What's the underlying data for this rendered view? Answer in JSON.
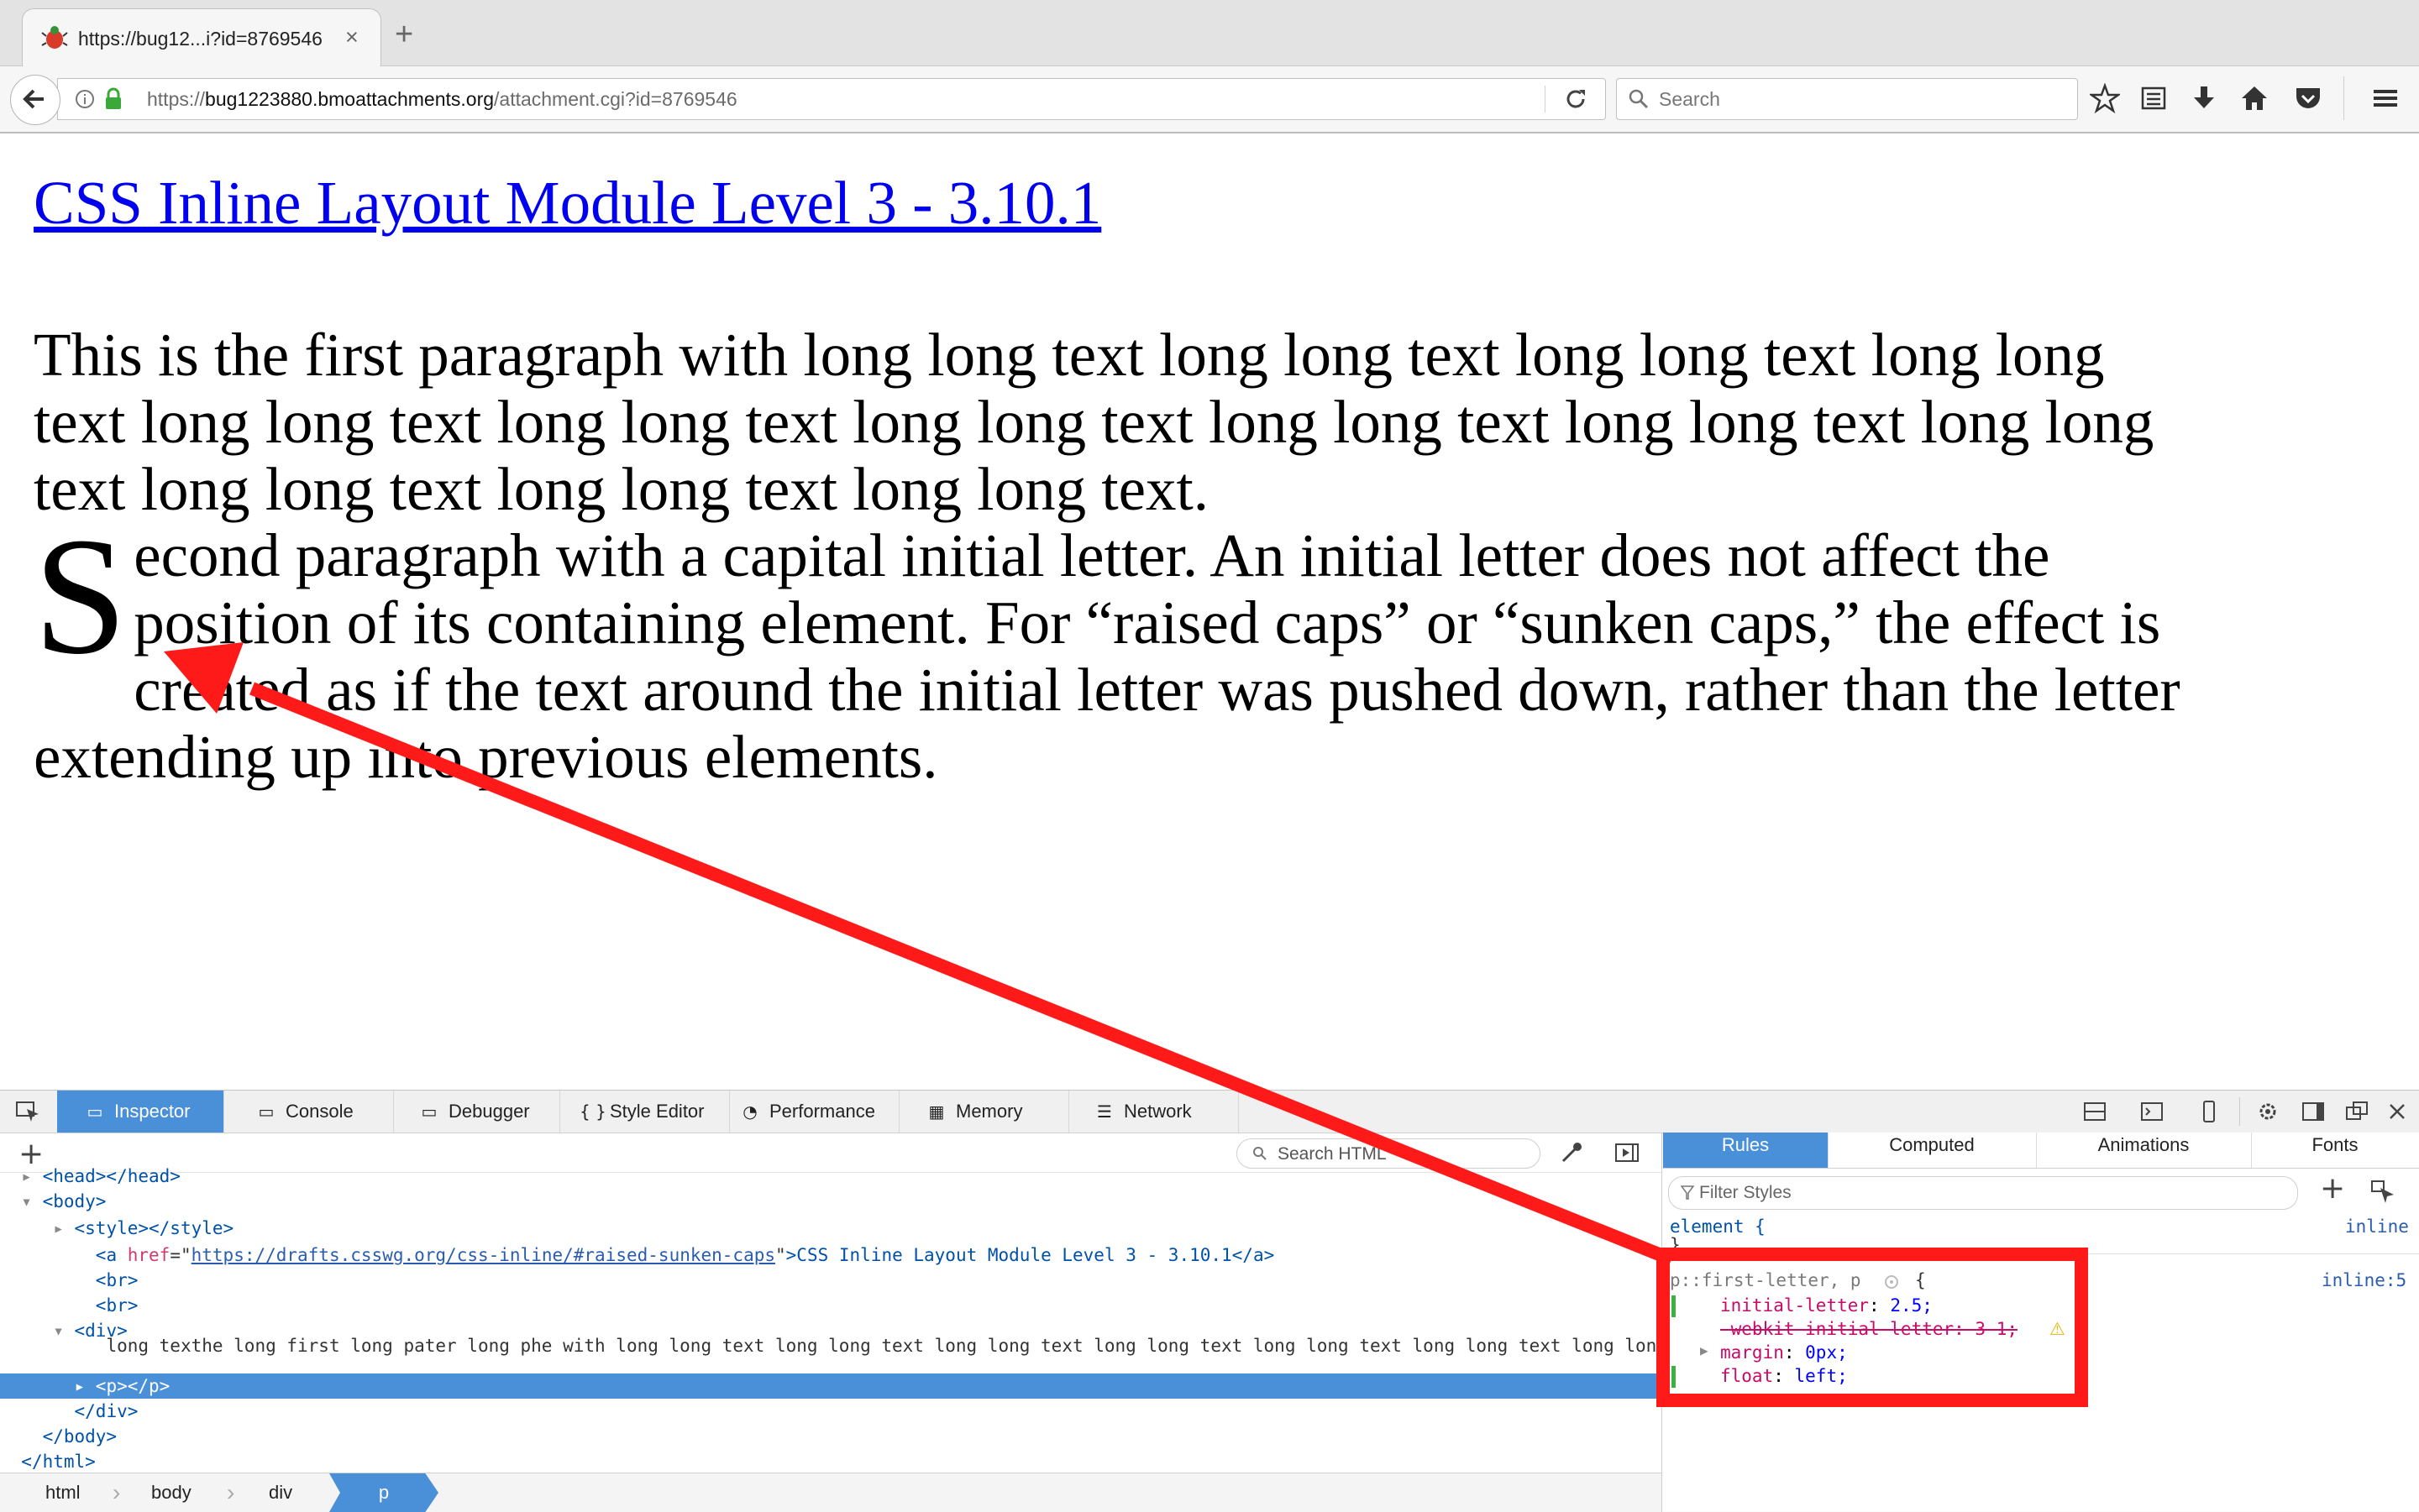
{
  "browser": {
    "tab_title": "https://bug12...i?id=8769546",
    "close_symbol": "×",
    "new_tab_symbol": "+",
    "url_prefix": "https://",
    "url_host": "bug1223880.bmoattachments.org",
    "url_path": "/attachment.cgi?id=8769546",
    "search_placeholder": "Search",
    "icons": [
      "back-icon",
      "info-icon",
      "lock-icon",
      "reload-icon",
      "search-icon",
      "star-icon",
      "reading-list-icon",
      "download-icon",
      "home-icon",
      "pocket-icon",
      "menu-icon"
    ]
  },
  "page": {
    "link_text": "CSS Inline Layout Module Level 3 - 3.10.1",
    "paragraph1": "This is the first paragraph with long long text long long text long long text long long text long long text long long text long long text long long text long long text long long text long long text long long text long long text.",
    "initial_letter": "S",
    "paragraph2_rest": "econd paragraph with a capital initial letter. An initial letter does not affect the position of its containing element. For “raised caps” or “sunken caps,” the effect is created as if the text around the initial letter was pushed down, rather than the letter extending up into previous elements."
  },
  "devtools": {
    "tabs": [
      {
        "label": "Inspector",
        "icon": "▭"
      },
      {
        "label": "Console",
        "icon": "▭"
      },
      {
        "label": "Debugger",
        "icon": "▭"
      },
      {
        "label": "Style Editor",
        "icon": "{ }"
      },
      {
        "label": "Performance",
        "icon": "◔"
      },
      {
        "label": "Memory",
        "icon": "▦"
      },
      {
        "label": "Network",
        "icon": "☰"
      }
    ],
    "search_html_placeholder": "Search HTML",
    "tree": {
      "head": "<head></head>",
      "body_open": "<body>",
      "style": "<style></style>",
      "a_open": "<a",
      "a_attr": "href",
      "a_href": "https://drafts.csswg.org/css-inline/#raised-sunken-caps",
      "a_text": ">CSS Inline Layout Module Level 3 - 3.10.1</a>",
      "br1": "<br>",
      "br2": "<br>",
      "div_open": "<div>",
      "overlap_text": "long texthe long first long pater long phe with long long text long long text long long text long long text long long text long long text long long text long long text long long text long long text long",
      "p_selected": "<p></p>",
      "div_close": "</div>",
      "body_close": "</body>",
      "html_close": "</html>"
    },
    "breadcrumbs": [
      "html",
      "body",
      "div",
      "p"
    ],
    "rules_tabs": [
      "Rules",
      "Computed",
      "Animations",
      "Fonts"
    ],
    "filter_placeholder": "Filter Styles",
    "rule_element_selector": "element {",
    "rule_element_close": "}",
    "rule_element_source": "inline",
    "rule2_selector": "p::first-letter, p",
    "rule2_brace": "{",
    "rule2_source": "inline:5",
    "decl1_prop": "initial-letter",
    "decl1_val": "2.5;",
    "decl2_text": "-webkit-initial-letter: 3 1;",
    "decl3_prop": "margin",
    "decl3_val": "0px;",
    "decl4_prop": "float",
    "decl4_val": "left;",
    "warning_symbol": "⚠"
  },
  "colors": {
    "accent": "#4a90d9",
    "link": "#0000ee",
    "annotation": "#ff1a1a"
  }
}
